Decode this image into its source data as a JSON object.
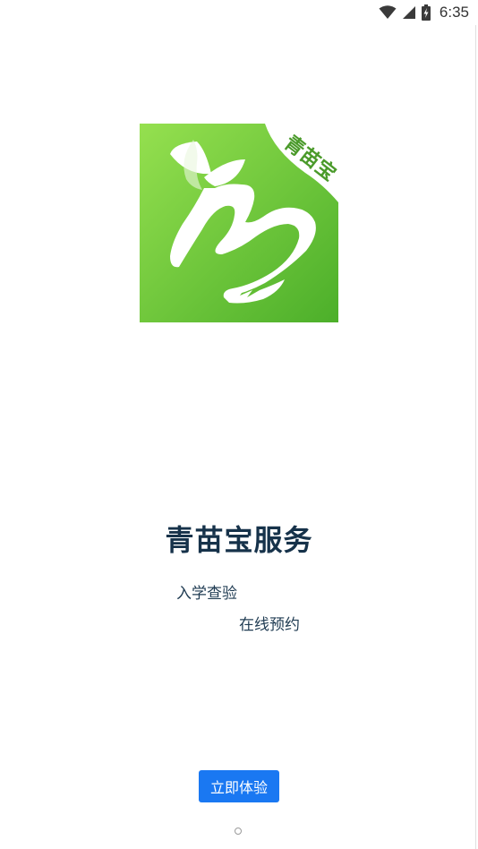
{
  "status_bar": {
    "time": "6:35",
    "icons": [
      "wifi-icon",
      "cellular-signal-icon",
      "battery-charging-icon"
    ]
  },
  "logo": {
    "label": "青苗宝",
    "colors": {
      "gradient_start": "#95e04f",
      "gradient_end": "#4caf2a",
      "text": "#4a9a2a"
    }
  },
  "main": {
    "title": "青苗宝服务",
    "subtitle_1": "入学查验",
    "subtitle_2": "在线预约"
  },
  "cta": {
    "label": "立即体验",
    "color": "#1a78f2"
  },
  "pager": {
    "current": 1,
    "total": 1
  }
}
